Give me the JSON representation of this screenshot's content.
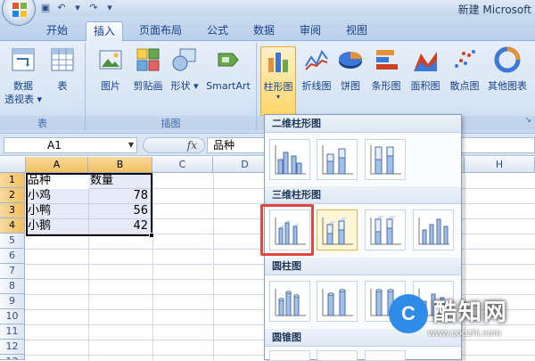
{
  "window": {
    "title": "新建 Microsoft"
  },
  "tabs": [
    "开始",
    "插入",
    "页面布局",
    "公式",
    "数据",
    "审阅",
    "视图"
  ],
  "active_tab": "插入",
  "ribbon": {
    "groups": [
      {
        "label": "表",
        "buttons": [
          "数据\n透视表",
          "表"
        ]
      },
      {
        "label": "插图",
        "buttons": [
          "图片",
          "剪贴画",
          "形状",
          "SmartArt"
        ]
      },
      {
        "label": "",
        "buttons": [
          "柱形图",
          "折线图",
          "饼图",
          "条形图",
          "面积图",
          "散点图",
          "其他图表"
        ]
      }
    ],
    "table_group_label": "表",
    "pivot_label": "数据",
    "pivot_label2": "透视表",
    "table_label": "表",
    "illus_group_label": "插图",
    "picture_label": "图片",
    "clipart_label": "剪贴画",
    "shapes_label": "形状",
    "smartart_label": "SmartArt",
    "column_label": "柱形图",
    "line_label": "折线图",
    "pie_label": "饼图",
    "bar_label": "条形图",
    "area_label": "面积图",
    "scatter_label": "散点图",
    "other_label": "其他图表"
  },
  "formula_bar": {
    "name_box": "A1",
    "fx": "fx",
    "value": "品种"
  },
  "grid": {
    "columns": [
      "A",
      "B",
      "C",
      "D",
      "H"
    ],
    "rows": [
      "1",
      "2",
      "3",
      "4",
      "5",
      "6",
      "7",
      "8",
      "9",
      "10",
      "11",
      "12",
      "13"
    ],
    "cells": {
      "A1": "品种",
      "B1": "数量",
      "A2": "小鸡",
      "B2": "78",
      "A3": "小鸭",
      "B3": "56",
      "A4": "小鹅",
      "B4": "42"
    }
  },
  "chart_menu": {
    "sections": [
      "二维柱形图",
      "三维柱形图",
      "圆柱图",
      "圆锥图"
    ]
  },
  "watermark": {
    "text": "酷知网",
    "sub": "www.coozhi.com",
    "logo": "C"
  },
  "colors": {
    "accent_red": "#e2473f",
    "ribbon_blue": "#dae6f5",
    "selection": "#f1c15f"
  }
}
